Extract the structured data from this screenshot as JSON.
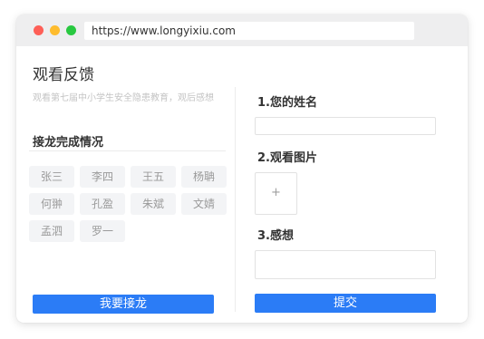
{
  "browser": {
    "url": "https://www.longyixiu.com"
  },
  "page": {
    "title": "观看反馈",
    "subtitle": "观看第七届中小学生安全隐患教育，观后感想"
  },
  "left_panel": {
    "section_title": "接龙完成情况",
    "names": [
      "张三",
      "李四",
      "王五",
      "杨聃",
      "何翀",
      "孔盈",
      "朱斌",
      "文婧",
      "孟泗",
      "罗一"
    ],
    "join_button": "我要接龙"
  },
  "form": {
    "q1_label": "1.您的姓名",
    "q1_value": "",
    "q2_label": "2.观看图片",
    "upload_icon": "+",
    "q3_label": "3.感想",
    "q3_value": "",
    "submit_button": "提交"
  },
  "colors": {
    "accent": "#2b7cf6",
    "titlebar": "#eeeeef",
    "chip_bg": "#f3f4f6"
  }
}
